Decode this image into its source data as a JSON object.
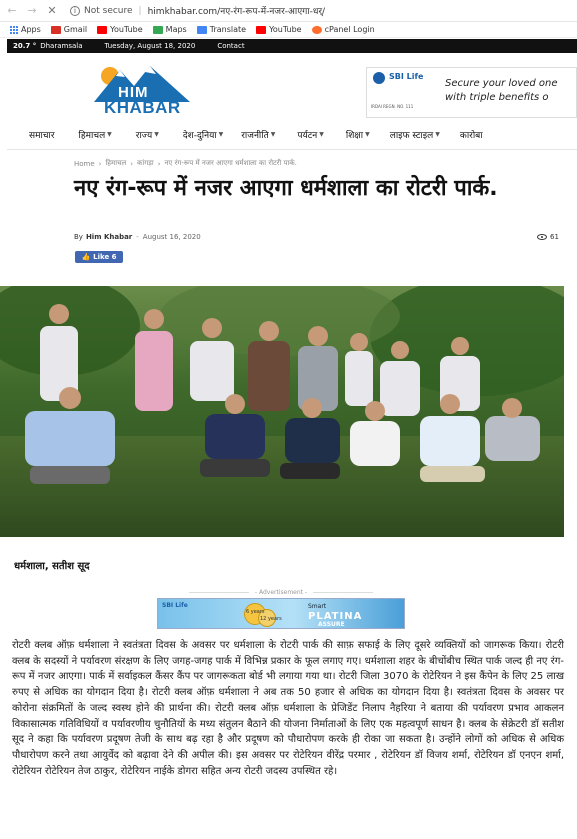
{
  "browser": {
    "security": "Not secure",
    "url": "himkhabar.com/नए-रंग-रूप-में-नजर-आएगा-धर्/",
    "bookmarks": [
      {
        "label": "Apps",
        "icon": "apps-grid-icon",
        "color": "#4285f4"
      },
      {
        "label": "Gmail",
        "icon": "gmail-icon",
        "color": "#d93025"
      },
      {
        "label": "YouTube",
        "icon": "youtube-icon",
        "color": "#ff0000"
      },
      {
        "label": "Maps",
        "icon": "maps-icon",
        "color": "#34a853"
      },
      {
        "label": "Translate",
        "icon": "translate-icon",
        "color": "#4285f4"
      },
      {
        "label": "YouTube",
        "icon": "youtube-icon",
        "color": "#ff0000"
      },
      {
        "label": "cPanel Login",
        "icon": "cpanel-icon",
        "color": "#ff6c2c"
      }
    ]
  },
  "topbar": {
    "temperature": "20.7 °",
    "city": "Dharamsala",
    "date": "Tuesday, August 18, 2020",
    "contact": "Contact"
  },
  "site": {
    "logo_top": "HIM",
    "logo_bottom": "KHABAR"
  },
  "header_ad": {
    "brand": "SBI Life",
    "line1": "Secure your loved one",
    "line2": "with triple benefits o",
    "reg": "IRDAI REGN. NO. 111"
  },
  "nav": {
    "items": [
      {
        "label": "समाचार",
        "caret": false
      },
      {
        "label": "हिमाचल",
        "caret": true
      },
      {
        "label": "राज्य",
        "caret": true
      },
      {
        "label": "देश-दुनिया",
        "caret": true
      },
      {
        "label": "राजनीति",
        "caret": true
      },
      {
        "label": "पर्यटन",
        "caret": true
      },
      {
        "label": "शिक्षा",
        "caret": true
      },
      {
        "label": "लाइफ स्टाइल",
        "caret": true
      },
      {
        "label": "कारोबा",
        "caret": false
      }
    ]
  },
  "breadcrumb": {
    "home": "Home",
    "section": "हिमाचल",
    "subsection": "कांगड़ा",
    "current": "नए रंग-रूप में नजर आएगा धर्मशाला का रोटरी पार्क."
  },
  "article": {
    "title": "नए रंग-रूप में नजर आएगा धर्मशाला का रोटरी पार्क.",
    "by": "By",
    "author": "Him Khabar",
    "date": "August 16, 2020",
    "views": "61",
    "like": "Like 6",
    "dateline": "धर्मशाला, सतीश सूद",
    "advertisement_label": "- Advertisement -",
    "body": "रोटरी क्लब ऑफ़ धर्मशाला ने स्वतंत्रता दिवस के अवसर पर धर्मशाला के रोटरी पार्क की साफ़ सफाई के लिए दूसरे व्यक्तियों को जागरूक किया। रोटरी क्लब के सदस्यों ने पर्यावरण संरक्षण के लिए जगह-जगह पार्क में विभिन्न प्रकार के फूल लगाए गए। धर्मशाला शहर के बीचोंबीच स्थित पार्क जल्द ही नए रंग-रूप में नजर आएगा। पार्क में सर्वाइकल कैंसर कैंप पर जागरूकता बोर्ड भी लगाया गया था। रोटरी जिला 3070 के रोटेरियन ने इस कैंपेन के लिए 25 लाख रुपए से अधिक का योगदान दिया है। रोटरी क्लब ऑफ़ धर्मशाला ने अब तक 50 हजार से अधिक का योगदान दिया है। स्वतंत्रता दिवस के अवसर पर कोरोना संक्रमितों के जल्द स्वस्थ होने की प्रार्थना की। रोटरी क्लब ऑफ़ धर्मशाला के प्रेजिडेंट निलाप नैहरिया ने बताया की पर्यावरण प्रभाव आकलन विकासात्मक गतिविधियों व पर्यावरणीय चुनौतियों के मध्य संतुलन बैठाने की योजना निर्माताओं के लिए एक महत्वपूर्ण साधन है। क्लब के सेक्रेटरी डॉ सतीश सूद ने कहा कि पर्यावरण प्रदूषण तेजी के साथ बढ़ रहा है और प्रदूषण को पौधारोपण करके ही रोका जा सकता है। उन्होंने लोगों को अधिक से अधिक पौधारोपण करने तथा आयुर्वेद को बढ़ावा देने की अपील की। इस अवसर पर रोटेरियन वीरेंद्र परमार , रोटेरियन डॉ विजय शर्मा, रोटेरियन डॉ एनएन शर्मा, रोटेरियन रोटेरियन तेज ठाकुर, रोटेरियन नाईके डोगरा सहित अन्य रोटरी जदस्य उपस्थित रहे।"
  },
  "inline_ad": {
    "brand": "SBI Life",
    "line1": "Smart",
    "line2": "PLATINA",
    "line3": "ASSURE",
    "badge1": "6 years",
    "badge2": "12 years"
  },
  "colors": {
    "topbar_bg": "#111111",
    "logo_blue": "#1a6fb3",
    "logo_orange": "#f5a623",
    "facebook": "#4267b2"
  }
}
